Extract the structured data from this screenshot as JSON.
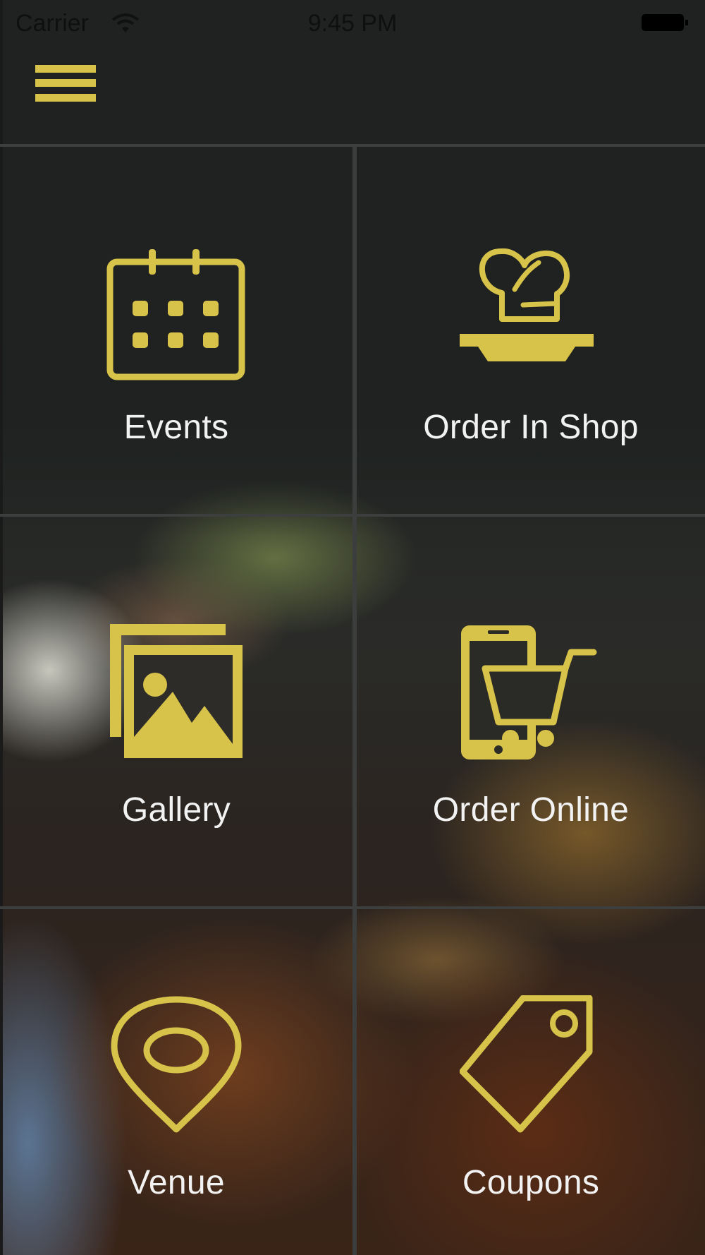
{
  "status_bar": {
    "carrier": "Carrier",
    "time": "9:45 PM"
  },
  "nav": {
    "menu_icon": "hamburger-menu-icon"
  },
  "tiles": [
    {
      "label": "Events",
      "icon": "calendar-icon"
    },
    {
      "label": "Order In Shop",
      "icon": "chef-hat-icon"
    },
    {
      "label": "Gallery",
      "icon": "gallery-icon"
    },
    {
      "label": "Order Online",
      "icon": "phone-cart-icon"
    },
    {
      "label": "Venue",
      "icon": "location-pin-icon"
    },
    {
      "label": "Coupons",
      "icon": "coupon-tag-icon"
    }
  ],
  "colors": {
    "accent": "#d7c349",
    "label": "#f2f2f2",
    "divider": "#3c3f3e"
  }
}
